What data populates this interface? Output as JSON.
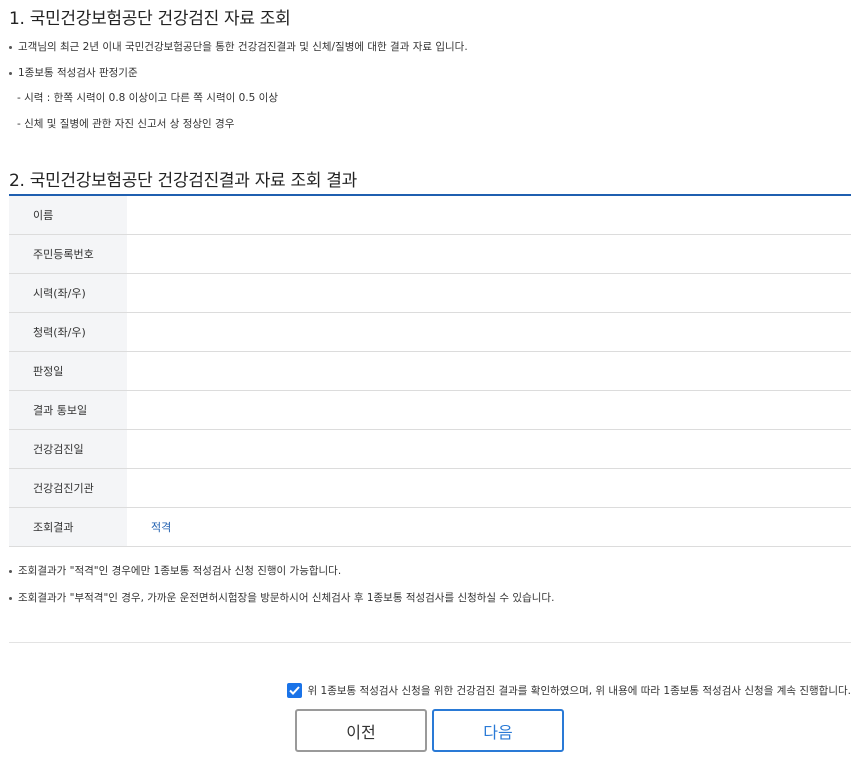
{
  "section1": {
    "title": "1. 국민건강보험공단 건강검진 자료 조회",
    "bullet1": "고객님의 최근 2년 이내 국민건강보험공단을 통한 건강검진결과 및 신체/질병에 대한 결과 자료 입니다.",
    "bullet2": "1종보통 적성검사 판정기준",
    "criteria1": "- 시력 : 한쪽 시력이 0.8 이상이고 다른 쪽 시력이 0.5 이상",
    "criteria2": "- 신체 및 질병에 관한 자진 신고서 상 정상인 경우"
  },
  "section2": {
    "title": "2. 국민건강보험공단 건강검진결과 자료 조회 결과",
    "rows": [
      {
        "label": "이름",
        "value": ""
      },
      {
        "label": "주민등록번호",
        "value": ""
      },
      {
        "label": "시력(좌/우)",
        "value": ""
      },
      {
        "label": "청력(좌/우)",
        "value": ""
      },
      {
        "label": "판정일",
        "value": ""
      },
      {
        "label": "결과 통보일",
        "value": ""
      },
      {
        "label": "건강검진일",
        "value": ""
      },
      {
        "label": "건강검진기관",
        "value": ""
      },
      {
        "label": "조회결과",
        "value": "적격"
      }
    ],
    "note1": "조회결과가 \"적격\"인 경우에만 1종보통 적성검사 신청 진행이 가능합니다.",
    "note2": "조회결과가 \"부적격\"인 경우, 가까운 운전면허시험장을 방문하시어 신체검사 후 1종보통 적성검사를 신청하실 수 있습니다."
  },
  "agreement": {
    "checked": true,
    "text": "위 1종보통 적성검사 신청을 위한 건강검진 결과를 확인하였으며, 위 내용에 따라 1종보통 적성검사 신청을 계속 진행합니다."
  },
  "buttons": {
    "prev": "이전",
    "next": "다음"
  }
}
